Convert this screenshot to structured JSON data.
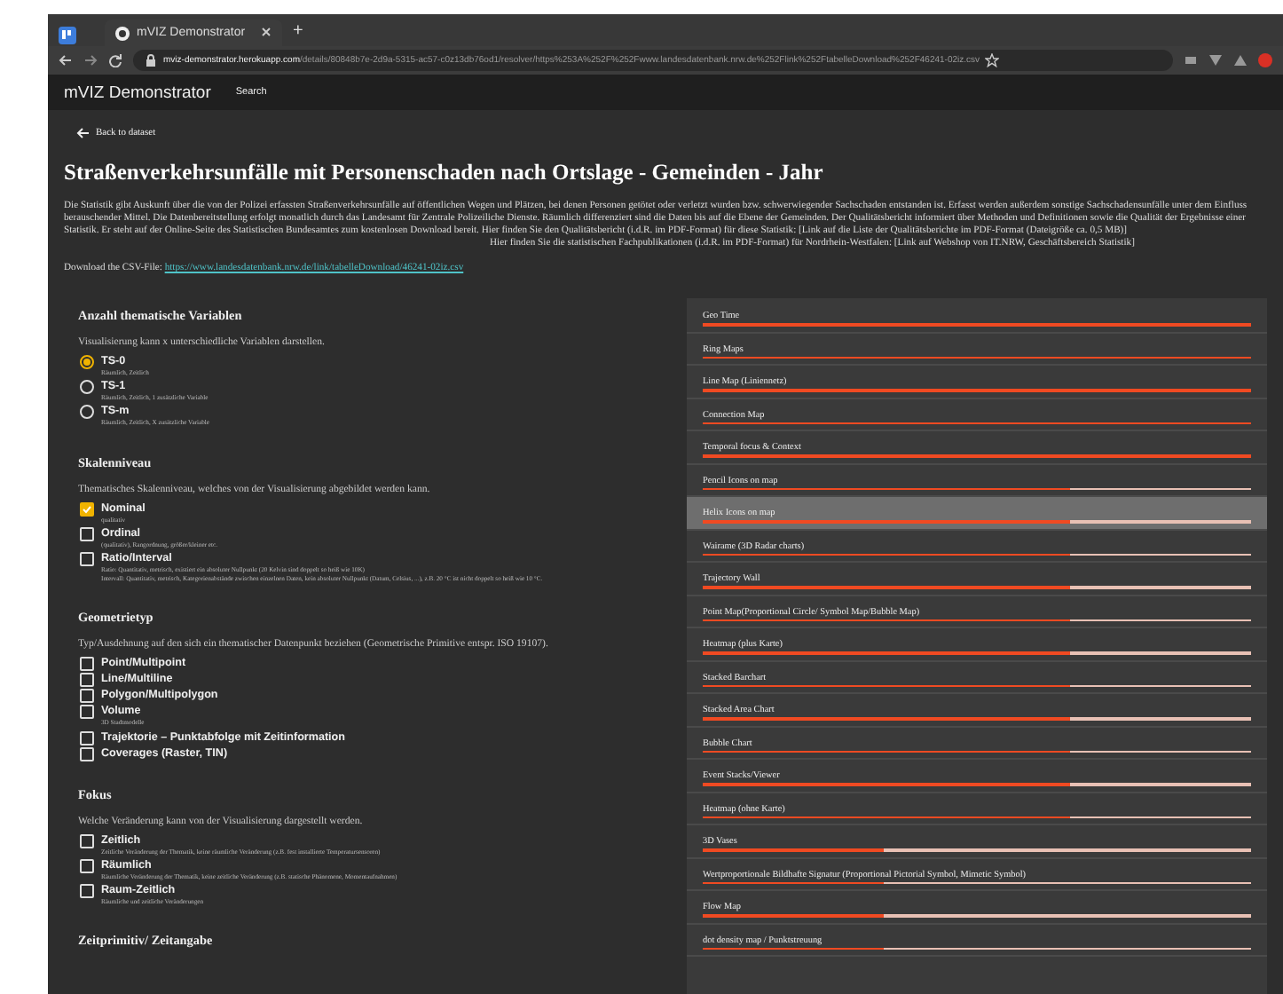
{
  "browser": {
    "tab_title": "mVIZ Demonstrator",
    "new_tab": "+",
    "url_host": "mviz-demonstrator.herokuapp.com",
    "url_path": "/details/80848b7e-2d9a-5315-ac57-c0z13db76od1/resolver/https%253A%252F%252Fwww.landesdatenbank.nrw.de%252Flink%252FtabelleDownload%252F46241-02iz.csv"
  },
  "navbar": {
    "brand": "mVIZ Demonstrator",
    "links": [
      "Search"
    ]
  },
  "back_link": "Back to dataset",
  "title": "Straßenverkehrsunfälle mit Personenschaden nach Ortslage - Gemeinden - Jahr",
  "description": "Die Statistik gibt Auskunft über die von der Polizei erfassten Straßenverkehrsunfälle auf öffentlichen Wegen und Plätzen, bei denen Personen getötet oder verletzt wurden bzw. schwerwiegender Sachschaden entstanden ist. Erfasst werden außerdem sonstige Sachschadensunfälle unter dem Einfluss berauschender Mittel. Die Datenbereitstellung erfolgt monatlich durch das Landesamt für Zentrale Polizeiliche Dienste. Räumlich differenziert sind die Daten bis auf die Ebene der Gemeinden. Der Qualitätsbericht informiert über Methoden und Definitionen sowie die Qualität der Ergebnisse einer Statistik. Er steht auf der Online-Seite des Statistischen Bundesamtes zum kostenlosen Download bereit. Hier finden Sie den Qualitätsbericht (i.d.R. im PDF-Format) für diese Statistik: [Link auf die Liste der Qualitätsberichte im PDF-Format (Dateigröße ca. 0,5 MB)]",
  "description_2": "Hier finden Sie die statistischen Fachpublikationen (i.d.R. im PDF-Format) für Nordrhein-Westfalen: [Link auf Webshop von IT.NRW, Geschäftsbereich Statistik]",
  "download": {
    "label": "Download the CSV-File:",
    "link": "https://www.landesdatenbank.nrw.de/link/tabelleDownload/46241-02iz.csv"
  },
  "filters": [
    {
      "heading": "Anzahl thematische Variablen",
      "text": "Visualisierung kann x unterschiedliche Variablen darstellen.",
      "options": [
        {
          "kind": "radio",
          "label": "TS-0",
          "sub": [
            "Räumlich, Zeitlich"
          ],
          "checked": true
        },
        {
          "kind": "radio",
          "label": "TS-1",
          "sub": [
            "Räumlich, Zeitlich, 1 zusätzliche Variable"
          ],
          "checked": false
        },
        {
          "kind": "radio",
          "label": "TS-m",
          "sub": [
            "Räumlich, Zeitlich, X zusätzliche Variable"
          ],
          "checked": false
        }
      ]
    },
    {
      "heading": "Skalenniveau",
      "text": "Thematisches Skalenniveau, welches von der Visualisierung abgebildet werden kann.",
      "options": [
        {
          "kind": "checkbox",
          "label": "Nominal",
          "sub": [
            "qualitativ"
          ],
          "checked": true
        },
        {
          "kind": "checkbox",
          "label": "Ordinal",
          "sub": [
            "(qualitativ), Rangordnung, größer/kleiner etc."
          ],
          "checked": false
        },
        {
          "kind": "checkbox",
          "label": "Ratio/Interval",
          "sub": [
            "Ratio: Quantitativ, metrisch, existiert ein absoluter Nullpunkt (20 Kelvin sind doppelt so heiß wie 10K)",
            "Intervall: Quantitativ, metrisch, Kategorienabstände zwischen einzelnen Daten, kein absoluter Nullpunkt (Datum, Celsius, ...), z.B. 20 °C ist nicht doppelt so heiß wie 10 °C."
          ],
          "checked": false
        }
      ]
    },
    {
      "heading": "Geometrietyp",
      "text": "Typ/Ausdehnung auf den sich ein thematischer Datenpunkt beziehen (Geometrische Primitive entspr. ISO 19107).",
      "options": [
        {
          "kind": "checkbox",
          "label": "Point/Multipoint",
          "checked": false
        },
        {
          "kind": "checkbox",
          "label": "Line/Multiline",
          "checked": false
        },
        {
          "kind": "checkbox",
          "label": "Polygon/Multipolygon",
          "checked": false
        },
        {
          "kind": "checkbox",
          "label": "Volume",
          "sub": [
            "3D Stadtmodelle"
          ],
          "checked": false
        },
        {
          "kind": "checkbox",
          "label": "Trajektorie – Punktabfolge mit Zeitinformation",
          "checked": false
        },
        {
          "kind": "checkbox",
          "label": "Coverages (Raster, TIN)",
          "checked": false
        }
      ]
    },
    {
      "heading": "Fokus",
      "text": "Welche Veränderung kann von der Visualisierung dargestellt werden.",
      "options": [
        {
          "kind": "checkbox",
          "label": "Zeitlich",
          "sub": [
            "Zeitliche Veränderung der Thematik, keine räumliche Veränderung (z.B. fest installierte Temperatursensoren)"
          ],
          "checked": false
        },
        {
          "kind": "checkbox",
          "label": "Räumlich",
          "sub": [
            "Räumliche Veränderung der Thematik, keine zeitliche Veränderung (z.B. statische Phänomene, Momentaufnahmen)"
          ],
          "checked": false
        },
        {
          "kind": "checkbox",
          "label": "Raum-Zeitlich",
          "sub": [
            "Räumliche und zeitliche Veränderungen"
          ],
          "checked": false
        }
      ]
    },
    {
      "heading": "Zeitprimitiv/ Zeitangabe"
    }
  ],
  "visualizations": [
    {
      "name": "Geo Time",
      "level": 1,
      "highlighted": false
    },
    {
      "name": "Ring Maps",
      "level": 1,
      "highlighted": false
    },
    {
      "name": "Line Map (Liniennetz)",
      "level": 1,
      "highlighted": false
    },
    {
      "name": "Connection Map",
      "level": 1,
      "highlighted": false
    },
    {
      "name": "Temporal focus & Context",
      "level": 1,
      "highlighted": false
    },
    {
      "name": "Pencil Icons on map",
      "level": 0.67,
      "highlighted": false
    },
    {
      "name": "Helix Icons on map",
      "level": 0.67,
      "highlighted": true
    },
    {
      "name": "Wairame (3D Radar charts)",
      "level": 0.67,
      "highlighted": false
    },
    {
      "name": "Trajectory Wall",
      "level": 0.67,
      "highlighted": false
    },
    {
      "name": "Point Map(Proportional Circle/ Symbol Map/Bubble Map)",
      "level": 0.67,
      "highlighted": false
    },
    {
      "name": "Heatmap (plus Karte)",
      "level": 0.67,
      "highlighted": false
    },
    {
      "name": "Stacked Barchart",
      "level": 0.67,
      "highlighted": false
    },
    {
      "name": "Stacked Area Chart",
      "level": 0.67,
      "highlighted": false
    },
    {
      "name": "Bubble Chart",
      "level": 0.67,
      "highlighted": false
    },
    {
      "name": "Event Stacks/Viewer",
      "level": 0.67,
      "highlighted": false
    },
    {
      "name": "Heatmap (ohne Karte)",
      "level": 0.67,
      "highlighted": false
    },
    {
      "name": "3D Vases",
      "level": 0.33,
      "highlighted": false
    },
    {
      "name": "Wertproportionale Bildhafte Signatur (Proportional Pictorial Symbol, Mimetic Symbol)",
      "level": 0.33,
      "highlighted": false
    },
    {
      "name": "Flow Map",
      "level": 0.33,
      "highlighted": false
    },
    {
      "name": "dot density map / Punktstreuung",
      "level": 0.33,
      "highlighted": false
    }
  ]
}
